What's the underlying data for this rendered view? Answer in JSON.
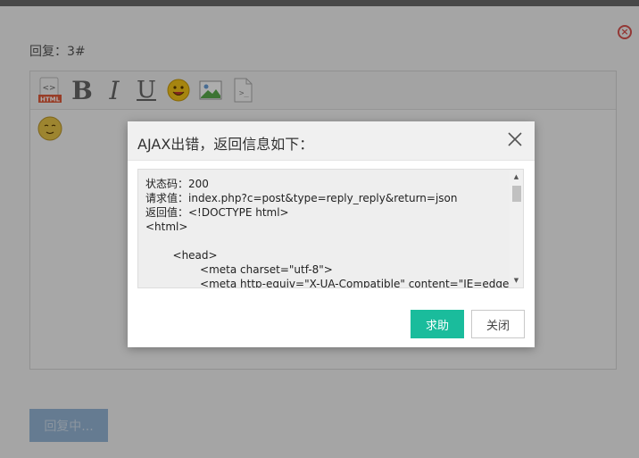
{
  "reply": {
    "title": "回复：3#",
    "submit_label": "回复中..."
  },
  "toolbar": {
    "html_label": "HTML",
    "bold_label": "B",
    "italic_label": "I",
    "underline_label": "U"
  },
  "modal": {
    "title": "AJAX出错，返回信息如下：",
    "log_lines": [
      "状态码：200",
      "请求值：index.php?c=post&type=reply_reply&return=json",
      "返回值：<!DOCTYPE html>",
      "<html>",
      "",
      "        <head>",
      "                <meta charset=\"utf-8\">",
      "                <meta http-equiv=\"X-UA-Compatible\" content=\"IE=edge,c"
    ],
    "help_label": "求助",
    "close_label": "关闭"
  },
  "colors": {
    "accent": "#1abc9c",
    "close_icon": "#d9534f",
    "submit_button": "#7fa7cf"
  }
}
